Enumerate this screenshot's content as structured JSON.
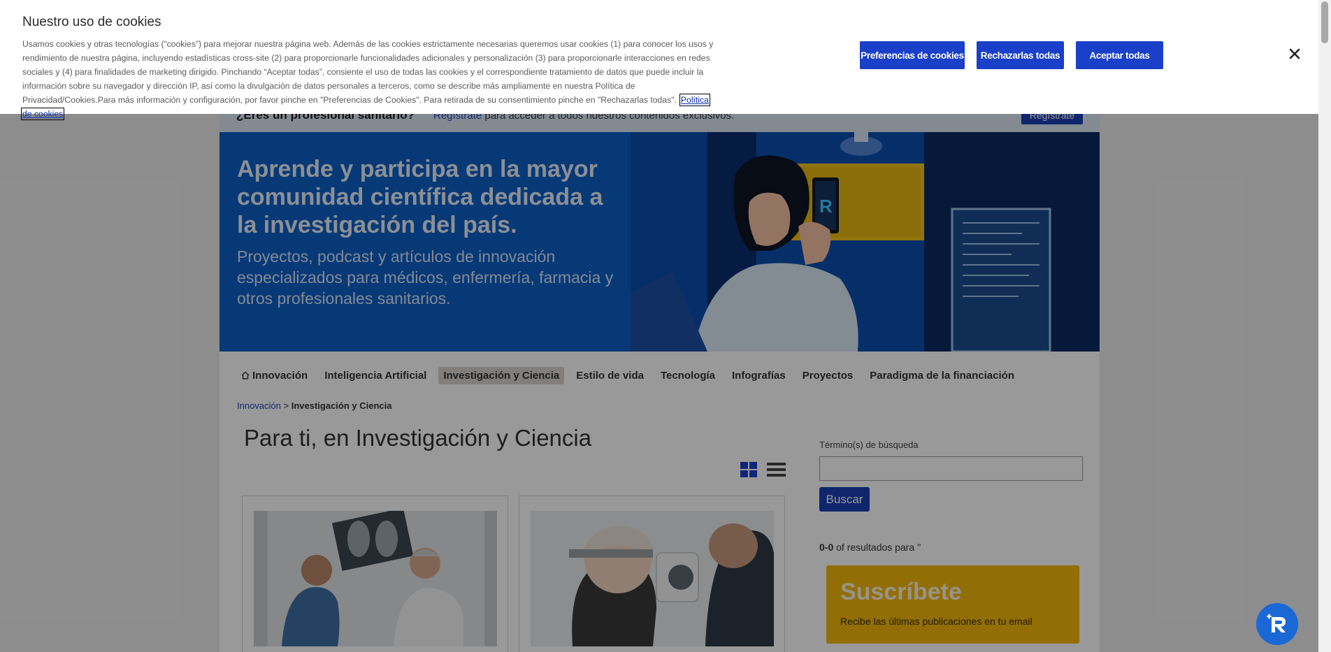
{
  "cookie_banner": {
    "title": "Nuestro uso de cookies",
    "text": "Usamos cookies y otras tecnologías (“cookies”) para mejorar nuestra página web. Además de las cookies estrictamente necesarias queremos usar cookies (1) para conocer los usos y rendimiento de nuestra página, incluyendo estadísticas cross-site (2) para proporcionarle funcionalidades adicionales y personalización (3) para proporcionarle interacciones en redes sociales y (4) para finalidades de marketing dirigido. Pinchando “Aceptar todas”, consiente el uso de todas las cookies y el correspondiente tratamiento de datos que puede incluir la información sobre su navegador y dirección IP, así como la divulgación de datos personales a terceros, como se describe más ampliamente en nuestra Política de Privacidad/Cookies.Para más información y configuración, por favor pinche en \"Preferencias de Cookies\". Para retirada de su consentimiento pinche en \"Rechazarlas todas\".",
    "policy_link": "Política de cookies",
    "preferences_label": "Preferencias de cookies",
    "reject_label": "Rechazarlas todas",
    "accept_label": "Aceptar todas",
    "close_icon": "close-icon"
  },
  "register_bar": {
    "question": "¿Eres un profesional sanitario?",
    "link": "Regístrate",
    "text": " para acceder a todos nuestros contenidos exclusivos.",
    "button": "Regístrate"
  },
  "hero": {
    "title": "Aprende y participa en la mayor comunidad científica dedicada a la investigación del país.",
    "subtitle": "Proyectos, podcast y artículos de innovación especializados para médicos, enfermería, farmacia y otros profesionales sanitarios."
  },
  "nav": {
    "items": [
      {
        "label": "Innovación",
        "icon": "home-icon"
      },
      {
        "label": "Inteligencia Artificial"
      },
      {
        "label": "Investigación y Ciencia",
        "active": true
      },
      {
        "label": "Estilo de vida"
      },
      {
        "label": "Tecnología"
      },
      {
        "label": "Infografías"
      },
      {
        "label": "Proyectos"
      },
      {
        "label": "Paradigma de la financiación"
      }
    ]
  },
  "breadcrumb": {
    "home": "Innovación",
    "separator": " > ",
    "current": "Investigación y Ciencia"
  },
  "main": {
    "title": "Para ti, en Investigación y Ciencia"
  },
  "sidebar": {
    "search_label": "Término(s) de búsqueda",
    "search_value": "",
    "search_button": "Buscar",
    "results_range": "0-0",
    "results_text": " of resultados para ''",
    "subscribe_title": "Suscríbete",
    "subscribe_text": "Recibe las últimas publicaciones en tu email"
  },
  "colors": {
    "primary_blue": "#1a3fc9",
    "hero_blue": "#0d5fc7",
    "subscribe_yellow": "#f4b70a"
  }
}
